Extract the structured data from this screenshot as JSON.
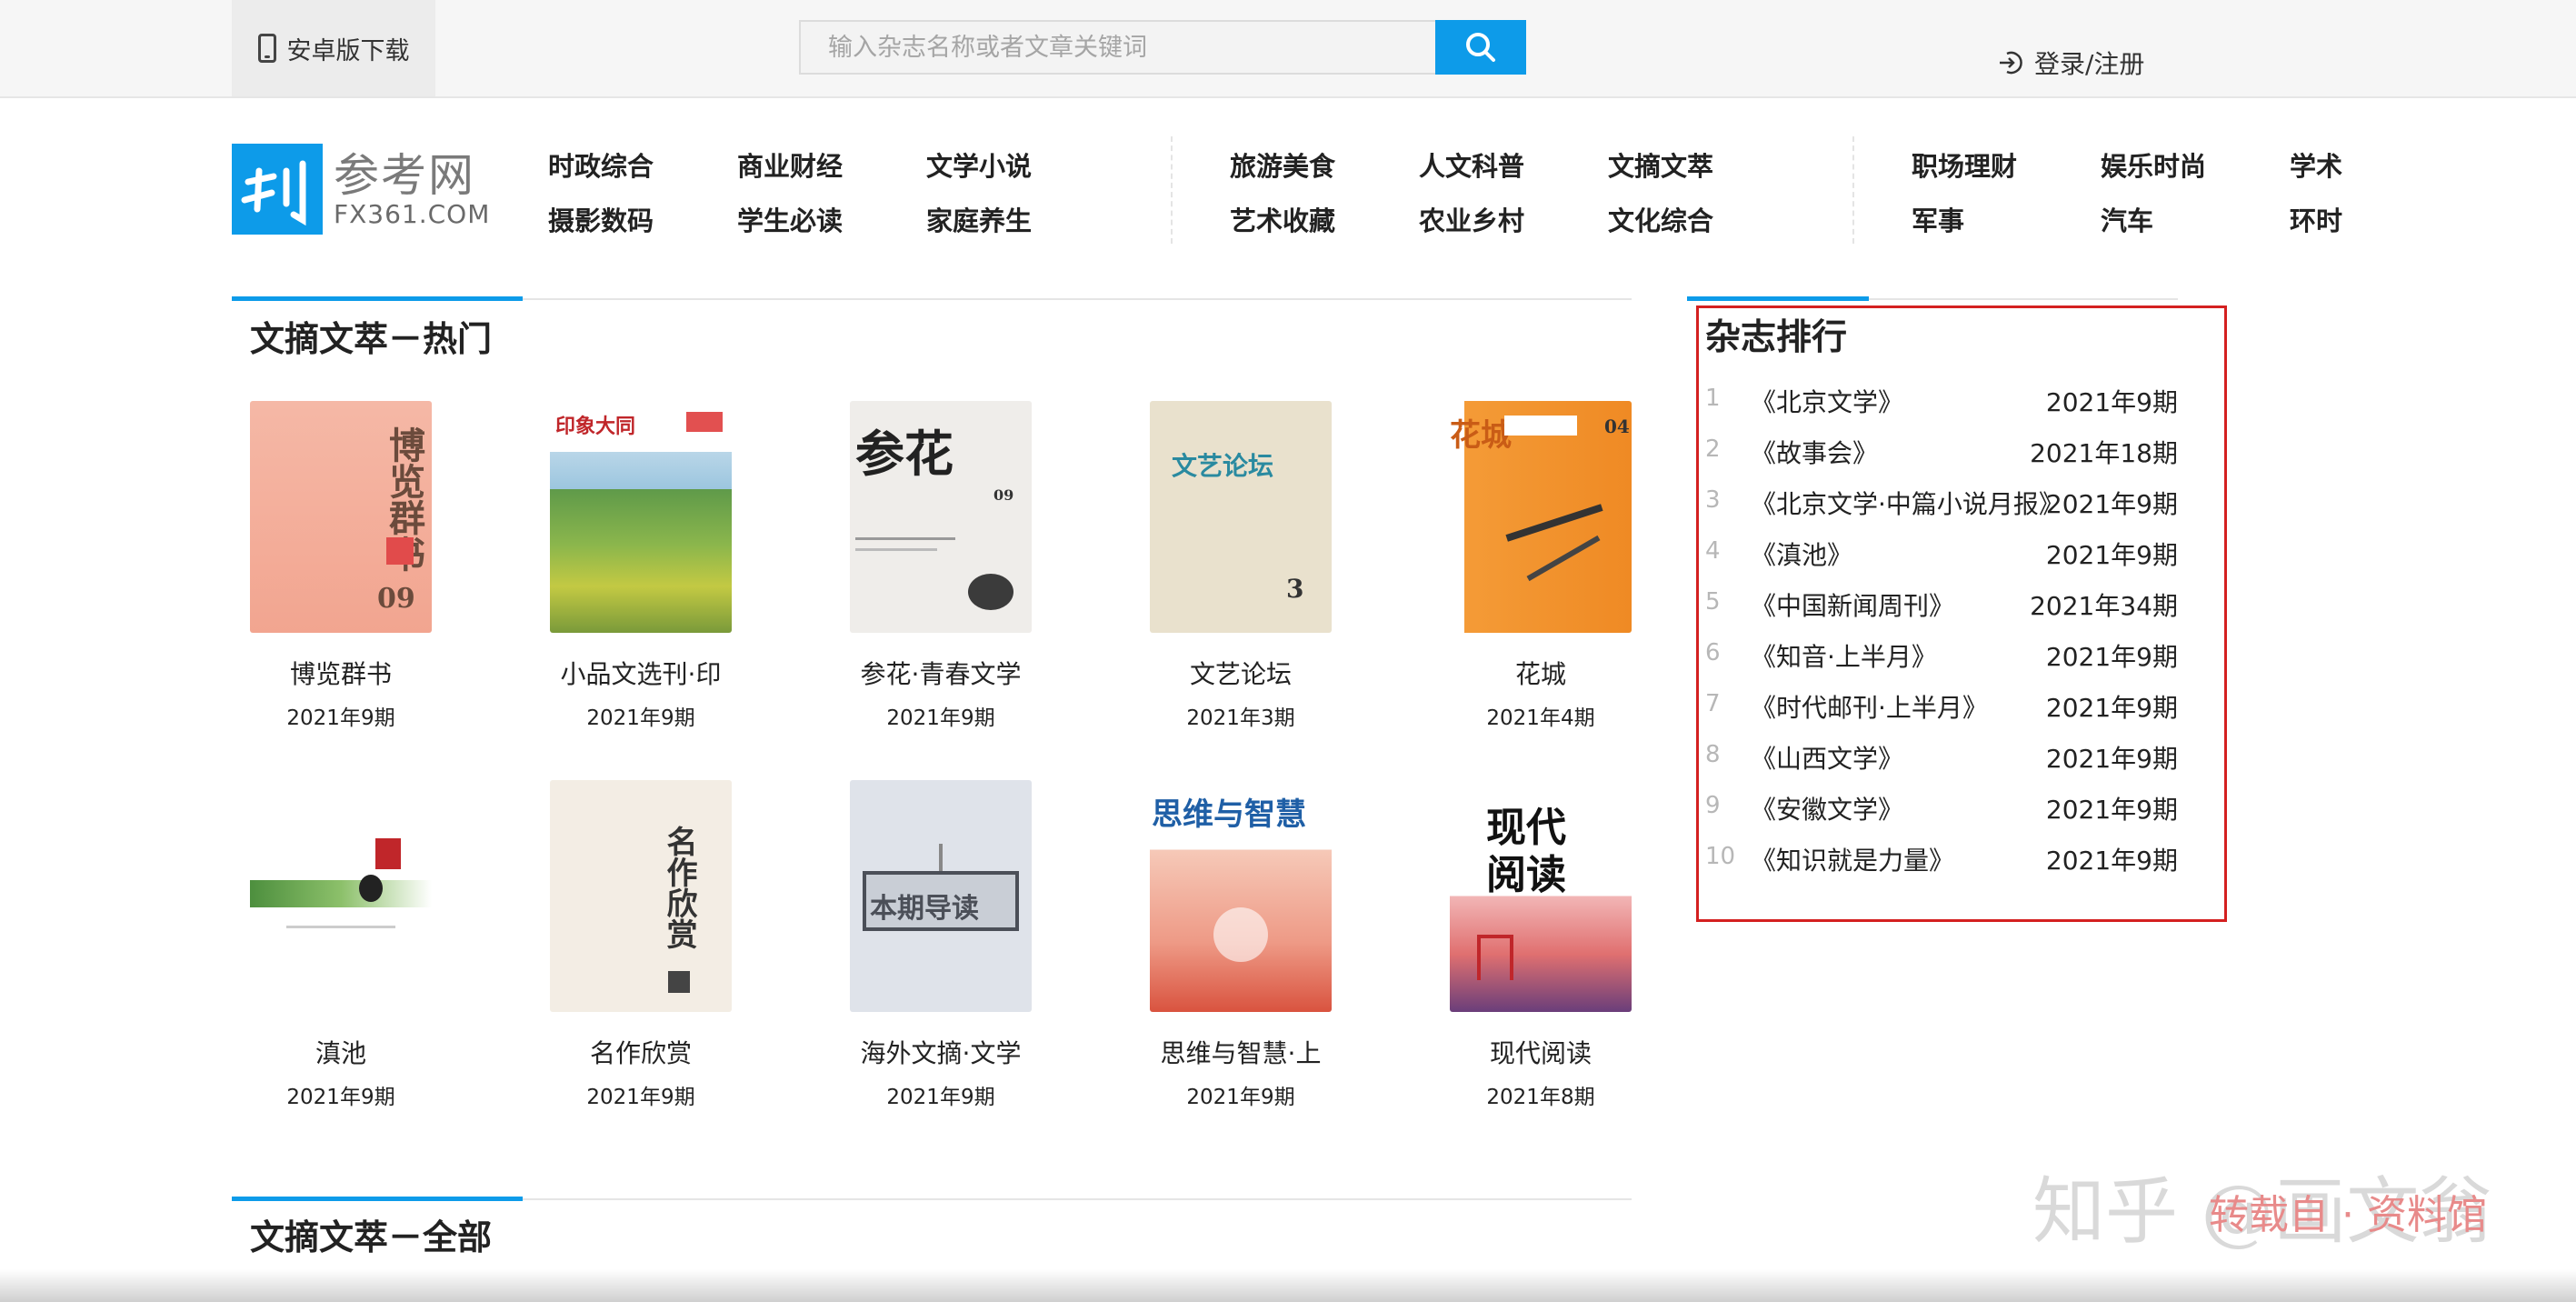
{
  "topbar": {
    "android_label": "安卓版下载",
    "search_placeholder": "输入杂志名称或者文章关键词",
    "login_label": "登录/注册"
  },
  "logo": {
    "cn": "参考网",
    "en": "FX361.COM"
  },
  "nav": {
    "group1": [
      "时政综合",
      "商业财经",
      "文学小说",
      "摄影数码",
      "学生必读",
      "家庭养生"
    ],
    "group2": [
      "旅游美食",
      "人文科普",
      "文摘文萃",
      "艺术收藏",
      "农业乡村",
      "文化综合"
    ],
    "group3": [
      "职场理财",
      "娱乐时尚",
      "学术",
      "军事",
      "汽车",
      "环时"
    ]
  },
  "hot": {
    "title": "文摘文萃－热门",
    "items": [
      {
        "name": "博览群书",
        "issue": "2021年9期"
      },
      {
        "name": "小品文选刊·印",
        "issue": "2021年9期"
      },
      {
        "name": "参花·青春文学",
        "issue": "2021年9期"
      },
      {
        "name": "文艺论坛",
        "issue": "2021年3期"
      },
      {
        "name": "花城",
        "issue": "2021年4期"
      },
      {
        "name": "滇池",
        "issue": "2021年9期"
      },
      {
        "name": "名作欣赏",
        "issue": "2021年9期"
      },
      {
        "name": "海外文摘·文学",
        "issue": "2021年9期"
      },
      {
        "name": "思维与智慧·上",
        "issue": "2021年9期"
      },
      {
        "name": "现代阅读",
        "issue": "2021年8期"
      }
    ]
  },
  "all": {
    "title": "文摘文萃－全部"
  },
  "ranking": {
    "title": "杂志排行",
    "items": [
      {
        "no": "1",
        "title": "《北京文学》",
        "issue": "2021年9期"
      },
      {
        "no": "2",
        "title": "《故事会》",
        "issue": "2021年18期"
      },
      {
        "no": "3",
        "title": "《北京文学·中篇小说月报》",
        "issue": "2021年9期"
      },
      {
        "no": "4",
        "title": "《滇池》",
        "issue": "2021年9期"
      },
      {
        "no": "5",
        "title": "《中国新闻周刊》",
        "issue": "2021年34期"
      },
      {
        "no": "6",
        "title": "《知音·上半月》",
        "issue": "2021年9期"
      },
      {
        "no": "7",
        "title": "《时代邮刊·上半月》",
        "issue": "2021年9期"
      },
      {
        "no": "8",
        "title": "《山西文学》",
        "issue": "2021年9期"
      },
      {
        "no": "9",
        "title": "《安徽文学》",
        "issue": "2021年9期"
      },
      {
        "no": "10",
        "title": "《知识就是力量》",
        "issue": "2021年9期"
      }
    ]
  },
  "watermark": {
    "text": "知乎 @画文翁",
    "sub": "转载自 · 资料馆"
  },
  "colors": {
    "accent": "#0d9be9",
    "highlight_border": "#d42020"
  }
}
